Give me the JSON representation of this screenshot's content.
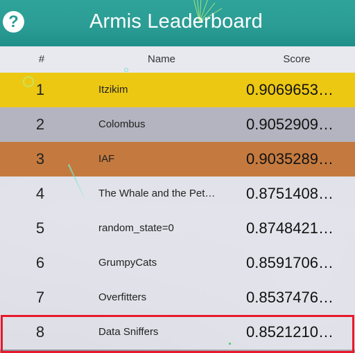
{
  "header": {
    "title": "Armis Leaderboard",
    "help_icon": "question-mark-icon"
  },
  "columns": {
    "rank": "#",
    "name": "Name",
    "score": "Score"
  },
  "rows": [
    {
      "rank": "1",
      "name": "Itzikim",
      "score": "0.9069653…",
      "medal": "gold"
    },
    {
      "rank": "2",
      "name": "Colombus",
      "score": "0.9052909…",
      "medal": "silver"
    },
    {
      "rank": "3",
      "name": "IAF",
      "score": "0.9035289…",
      "medal": "bronze"
    },
    {
      "rank": "4",
      "name": "The Whale and the Pet…",
      "score": "0.8751408…"
    },
    {
      "rank": "5",
      "name": "random_state=0",
      "score": "0.8748421…"
    },
    {
      "rank": "6",
      "name": "GrumpyCats",
      "score": "0.8591706…"
    },
    {
      "rank": "7",
      "name": "Overfitters",
      "score": "0.8537476…"
    },
    {
      "rank": "8",
      "name": "Data Sniffers",
      "score": "0.8521210…",
      "highlighted": true
    }
  ],
  "colors": {
    "header": "#2ea39a",
    "gold": "#ecc813",
    "silver": "#b3b4bf",
    "bronze": "#c47a3f",
    "highlight_border": "#e8192c"
  }
}
